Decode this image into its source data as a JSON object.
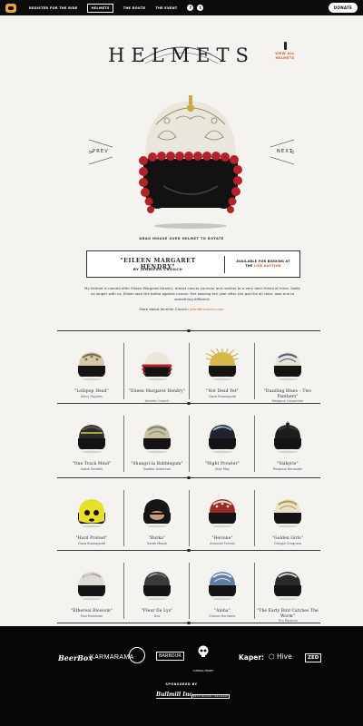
{
  "nav": {
    "links": [
      {
        "label": "REGISTER FOR THE RIDE",
        "active": false
      },
      {
        "label": "HELMETS",
        "active": true
      },
      {
        "label": "THE ROUTE",
        "active": false
      },
      {
        "label": "THE EVENT",
        "active": false
      }
    ],
    "social": [
      "facebook-icon",
      "twitter-icon"
    ],
    "donate_label": "DONATE"
  },
  "brand": "HELMETS",
  "view_all": [
    "VIEW ALL",
    "HELMETS"
  ],
  "carousel": {
    "prev": "PREV",
    "next": "NEXT",
    "hint": "DRAG MOUSE OVER HELMET TO ROTATE"
  },
  "featured": {
    "title": "\"EILEEN MARGARET HENDRY\"",
    "by": "BY JENNIFER CROUCH",
    "avail_line1": "AVAILABLE FOR BIDDING AT",
    "avail_prefix": "THE ",
    "avail_link": "LIVE AUCTION",
    "desc": "My helmet is named after Eileen Margaret Hendry, breast cancer survivor and mother to a very dear friend of mine. Sadly no longer with us, Eileen won the battle against cancer. Her passing ten year after she got the all clear, was due to something different.",
    "more_prefix": "More about Jennifer Crouch: ",
    "more_link": "jennifercrouch.com"
  },
  "helmets": [
    {
      "name": "\"Lollipop Head\"",
      "artist": "Kerry Hughes",
      "style": "lollipop"
    },
    {
      "name": "\"Eileen Margaret Hendry\"",
      "artist": "Jennifer Crouch",
      "style": "pompom"
    },
    {
      "name": "\"Not Dead Yet\"",
      "artist": "Dave Buonaguidi",
      "style": "spikes"
    },
    {
      "name": "\"Dazzling Blues – Two Panthers\"",
      "artist": "Margaux Carpentier",
      "style": "panthers"
    },
    {
      "name": "\"One Track Mind\"",
      "artist": "Adam Santelli",
      "style": "track"
    },
    {
      "name": "\"Shangri-la Bubblegum\"",
      "artist": "Dobbie Anderson",
      "style": "shangri"
    },
    {
      "name": "\"Night Prowler\"",
      "artist": "Stay May",
      "style": "night"
    },
    {
      "name": "\"Valkyrie\"",
      "artist": "Margaux Renaudin",
      "style": "valkyrie"
    },
    {
      "name": "\"Hard Protest\"",
      "artist": "Dave Buonaguidi",
      "style": "protest"
    },
    {
      "name": "\"Burka\"",
      "artist": "Sarah Maple",
      "style": "burka"
    },
    {
      "name": "\"Heroine\"",
      "artist": "Amanda Forrest",
      "style": "heroine"
    },
    {
      "name": "\"Golden Girls\"",
      "artist": "Giorgia Grugnola",
      "style": "golden"
    },
    {
      "name": "\"Ethereal Blossom\"",
      "artist": "Paul Robinson",
      "style": "blossom"
    },
    {
      "name": "\"Fleur De Lys\"",
      "artist": "Dzo",
      "style": "fleur"
    },
    {
      "name": "\"Aloha\"",
      "artist": "Sharon Surname",
      "style": "aloha"
    },
    {
      "name": "\"The Early Bird Catches The Worm\"",
      "artist": "Tim Rocknia",
      "style": "earlybird"
    }
  ],
  "footer": {
    "sponsors": [
      "BeerBox",
      "KARMARAMA",
      "BARBOUR",
      "CARDINAL HELMET",
      "Kaper:",
      "Hive",
      "ZED"
    ],
    "sponsored_by": "SPONSORED BY",
    "sponsors_bottom": [
      "Bullmill Inc.",
      "RESTORATION HARDWARE"
    ]
  },
  "colors": {
    "accent": "#d4582a",
    "dark": "#0c0c0c",
    "pompom": "#b3212b"
  }
}
